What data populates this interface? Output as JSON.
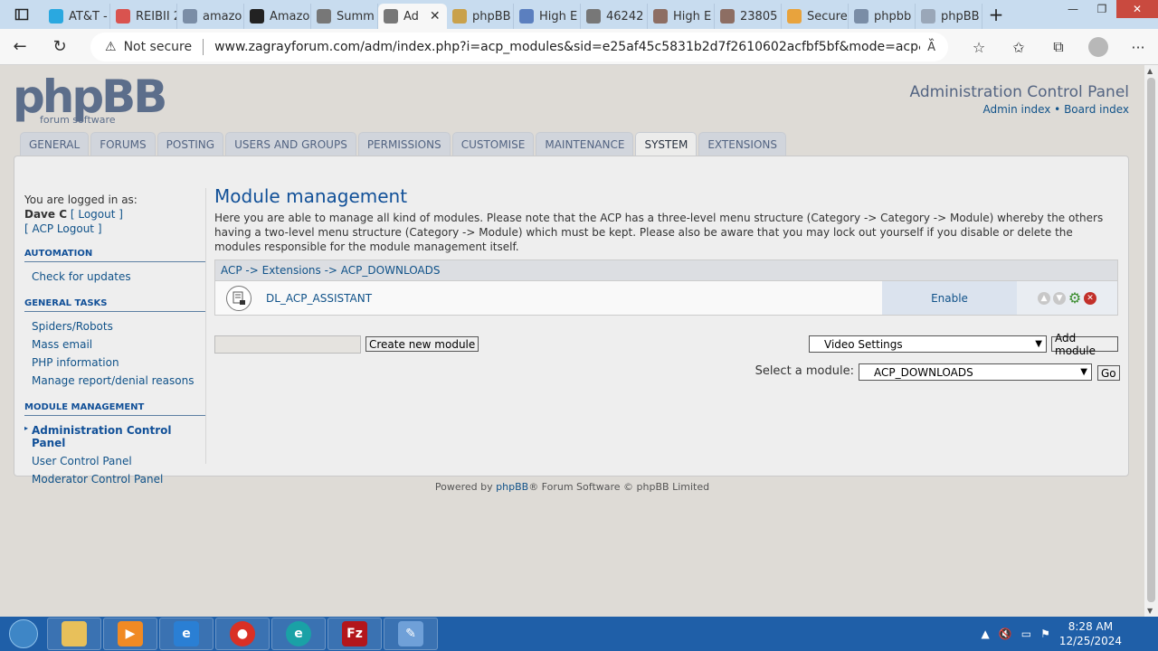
{
  "browser": {
    "tabs": [
      {
        "label": "AT&T -",
        "color": "#2aa8e0"
      },
      {
        "label": "REIBII 2",
        "color": "#d9534f"
      },
      {
        "label": "amazo",
        "color": "#7a8da6"
      },
      {
        "label": "Amazo",
        "color": "#222222"
      },
      {
        "label": "Summ",
        "color": "#777777"
      },
      {
        "label": "Ad",
        "color": "#777777",
        "active": true
      },
      {
        "label": "phpBB",
        "color": "#c9a14b"
      },
      {
        "label": "High E",
        "color": "#5b7fbf"
      },
      {
        "label": "46242",
        "color": "#777777"
      },
      {
        "label": "High E",
        "color": "#8d6e63"
      },
      {
        "label": "23805",
        "color": "#8d6e63"
      },
      {
        "label": "Secure",
        "color": "#e8a33d"
      },
      {
        "label": "phpbb",
        "color": "#7a8da6"
      },
      {
        "label": "phpBB",
        "color": "#9aa7b8"
      }
    ],
    "security": "Not secure",
    "url": "www.zagrayforum.com/adm/index.php?i=acp_modules&sid=e25af45c5831b2d7f2610602acfbf5bf&mode=acp&parent_id=..."
  },
  "header": {
    "logo_text": "phpBB",
    "logo_sub": "forum software",
    "title": "Administration Control Panel",
    "admin_index": "Admin index",
    "bullet": "•",
    "board_index": "Board index"
  },
  "nav_tabs": [
    "GENERAL",
    "FORUMS",
    "POSTING",
    "USERS AND GROUPS",
    "PERMISSIONS",
    "CUSTOMISE",
    "MAINTENANCE",
    "SYSTEM",
    "EXTENSIONS"
  ],
  "sidebar": {
    "logged_in_label": "You are logged in as:",
    "user": "Dave C",
    "logout": "[ Logout ]",
    "acp_logout": "[ ACP Logout ]",
    "sections": [
      {
        "title": "AUTOMATION",
        "items": [
          "Check for updates"
        ]
      },
      {
        "title": "GENERAL TASKS",
        "items": [
          "Spiders/Robots",
          "Mass email",
          "PHP information",
          "Manage report/denial reasons"
        ]
      },
      {
        "title": "MODULE MANAGEMENT",
        "items": [
          "Administration Control Panel",
          "User Control Panel",
          "Moderator Control Panel"
        ]
      }
    ]
  },
  "main": {
    "title": "Module management",
    "description": "Here you are able to manage all kind of modules. Please note that the ACP has a three-level menu structure (Category -> Category -> Module) whereby the others having a two-level menu structure (Category -> Module) which must be kept. Please also be aware that you may lock out yourself if you disable or delete the modules responsible for the module management itself.",
    "breadcrumb": "ACP -> Extensions -> ACP_DOWNLOADS",
    "module_name": "DL_ACP_ASSISTANT",
    "enable_label": "Enable",
    "create_button": "Create new module",
    "video_select": "Video Settings",
    "add_button": "Add module",
    "select_label": "Select a module:",
    "module_select": "ACP_DOWNLOADS",
    "go_button": "Go"
  },
  "footer": {
    "powered": "Powered by",
    "phpbb": "phpBB",
    "rest": "® Forum Software © phpBB Limited"
  },
  "taskbar": {
    "time": "8:28 AM",
    "date": "12/25/2024"
  }
}
